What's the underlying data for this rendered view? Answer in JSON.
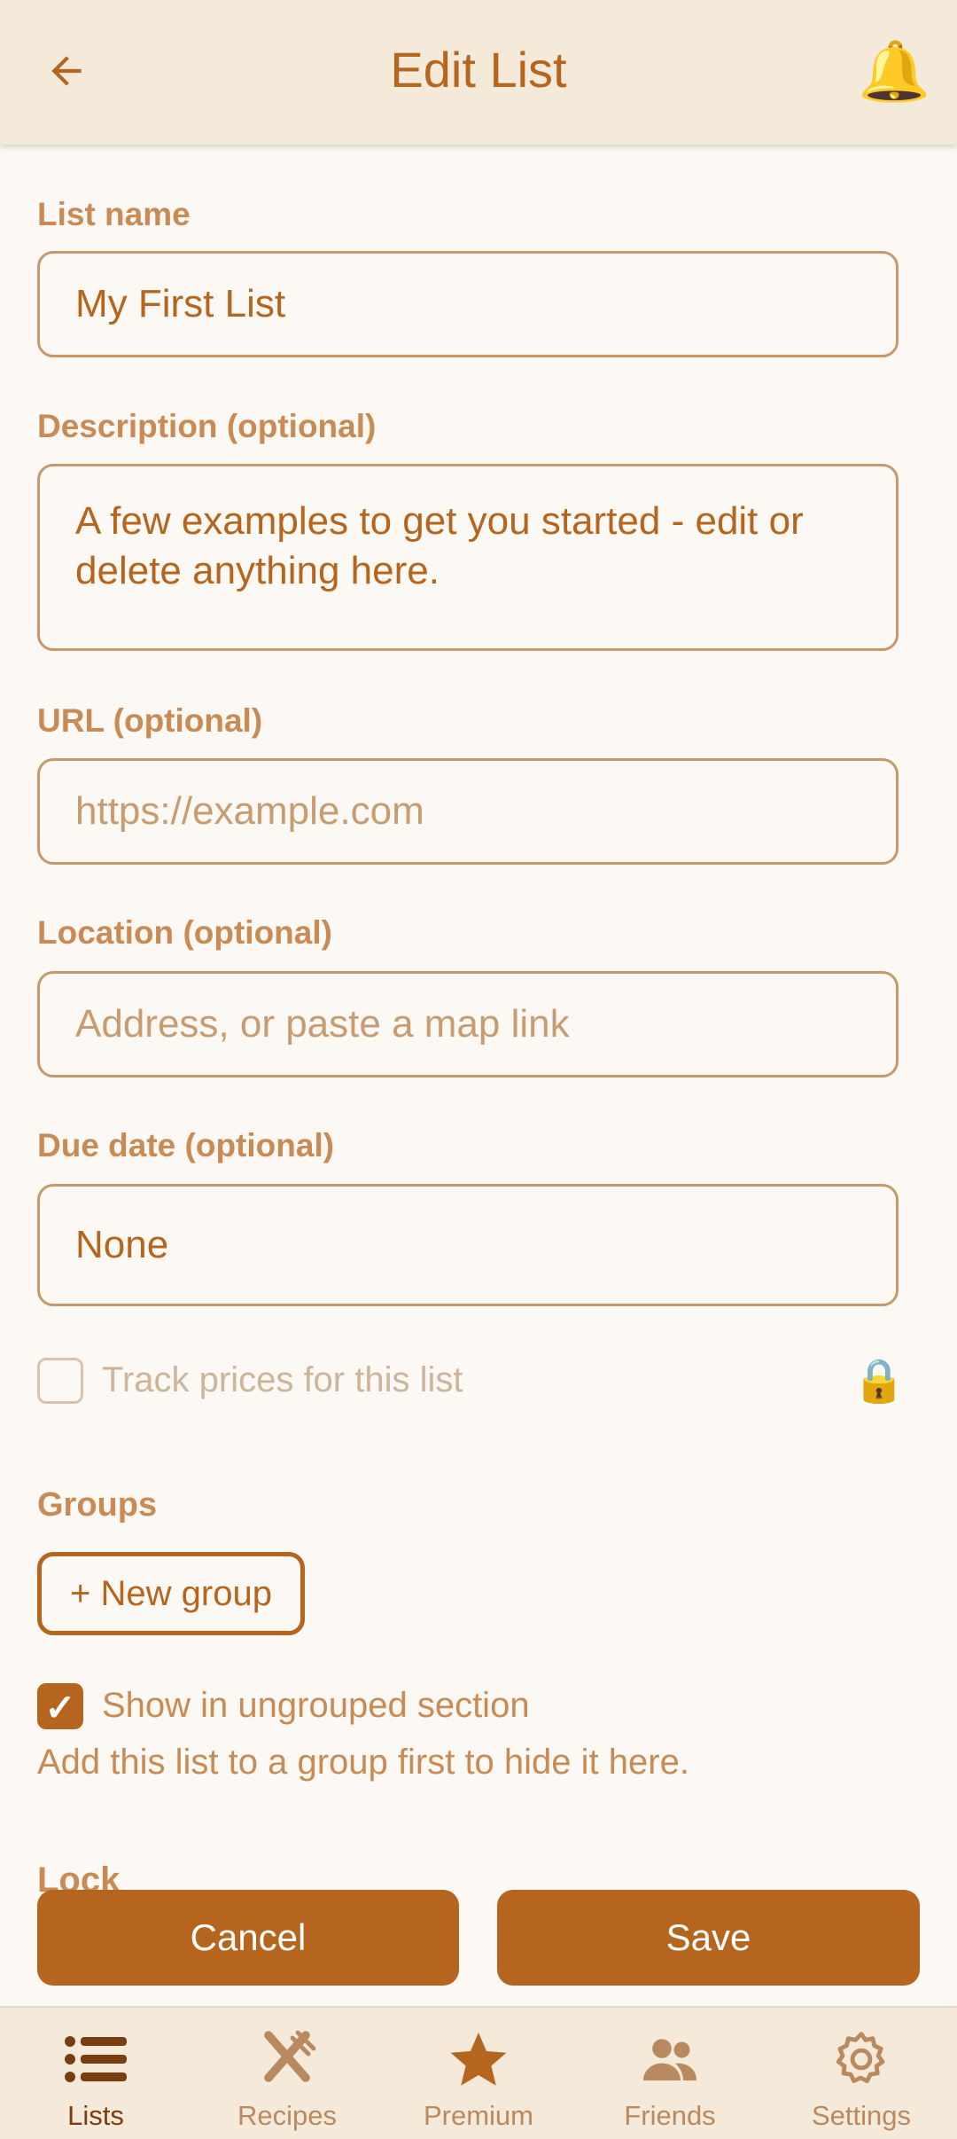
{
  "header": {
    "title": "Edit List",
    "back_icon": "arrow-left-icon",
    "bell_icon": "🔔"
  },
  "form": {
    "list_name": {
      "label": "List name",
      "value": "My First List"
    },
    "description": {
      "label": "Description (optional)",
      "value": "A few examples to get you started - edit or delete anything here."
    },
    "url": {
      "label": "URL (optional)",
      "placeholder": "https://example.com"
    },
    "location": {
      "label": "Location (optional)",
      "placeholder": "Address, or paste a map link"
    },
    "due_date": {
      "label": "Due date (optional)",
      "value": "None"
    },
    "track_prices": {
      "label": "Track prices for this list",
      "checked": false,
      "lock_icon": "🔒"
    },
    "groups": {
      "label": "Groups",
      "new_group_button": "+ New group",
      "show_ungrouped": {
        "label": "Show in ungrouped section",
        "checked": true,
        "check_glyph": "✓"
      },
      "hint": "Add this list to a group first to hide it here."
    },
    "lock_label": "Lock"
  },
  "actions": {
    "cancel": "Cancel",
    "save": "Save"
  },
  "nav": {
    "items": [
      {
        "label": "Lists",
        "icon": "list-icon",
        "active": true
      },
      {
        "label": "Recipes",
        "icon": "utensils-icon",
        "active": false
      },
      {
        "label": "Premium",
        "icon": "star-icon",
        "active": false
      },
      {
        "label": "Friends",
        "icon": "friends-icon",
        "active": false
      },
      {
        "label": "Settings",
        "icon": "gear-icon",
        "active": false
      }
    ]
  },
  "colors": {
    "accent": "#b5651d",
    "header_bg": "#f5e9da",
    "page_bg": "#fcf8f3",
    "label": "#c98b55"
  }
}
